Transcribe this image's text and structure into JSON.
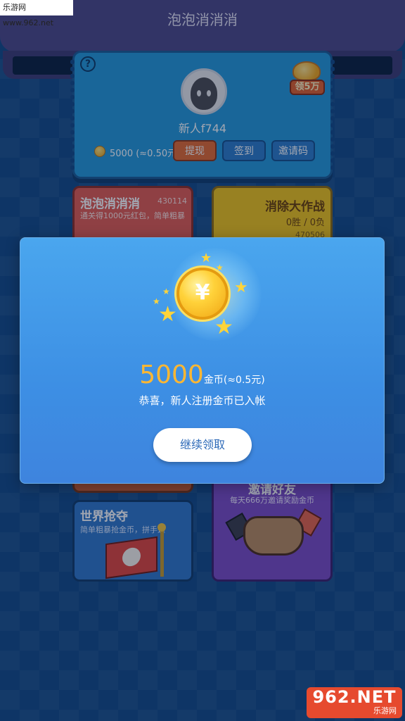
{
  "watermark_top": "乐游网 www.962.net",
  "header": {
    "title": "泡泡消消消"
  },
  "profile": {
    "reward_badge": "领5万",
    "username": "新人f744",
    "balance": "5000 (≈0.50元)",
    "buttons": {
      "withdraw": "提现",
      "sign_in": "签到",
      "invite_code": "邀请码"
    }
  },
  "tiles": {
    "bubble": {
      "title": "泡泡消消消",
      "players": "430114",
      "subtitle": "通关得1000元红包，简单粗暴"
    },
    "battle": {
      "title": "消除大作战",
      "record": "0胜 / 0负",
      "players": "470506"
    },
    "world": {
      "title": "世界抢夺",
      "subtitle": "简单粗暴抢金币，拼手速"
    },
    "invite": {
      "title": "邀请好友",
      "subtitle": "每天666万邀请奖励金币"
    }
  },
  "modal": {
    "coin_symbol": "¥",
    "amount": "5000",
    "amount_unit": "金币(≈0.5元)",
    "message": "恭喜，新人注册金币已入帐",
    "button": "继续领取"
  },
  "watermark_bottom": {
    "logo": "962.NET",
    "name": "乐游网"
  },
  "colors": {
    "modal_top": "#4aa6ee",
    "modal_bottom": "#3e84de",
    "amount": "#ffb732",
    "withdraw": "#e46a30",
    "background": "#134a87"
  },
  "icons": [
    "help-icon",
    "coin-icon",
    "avatar-icon",
    "star-icon",
    "flag-icon",
    "handshake-icon"
  ]
}
